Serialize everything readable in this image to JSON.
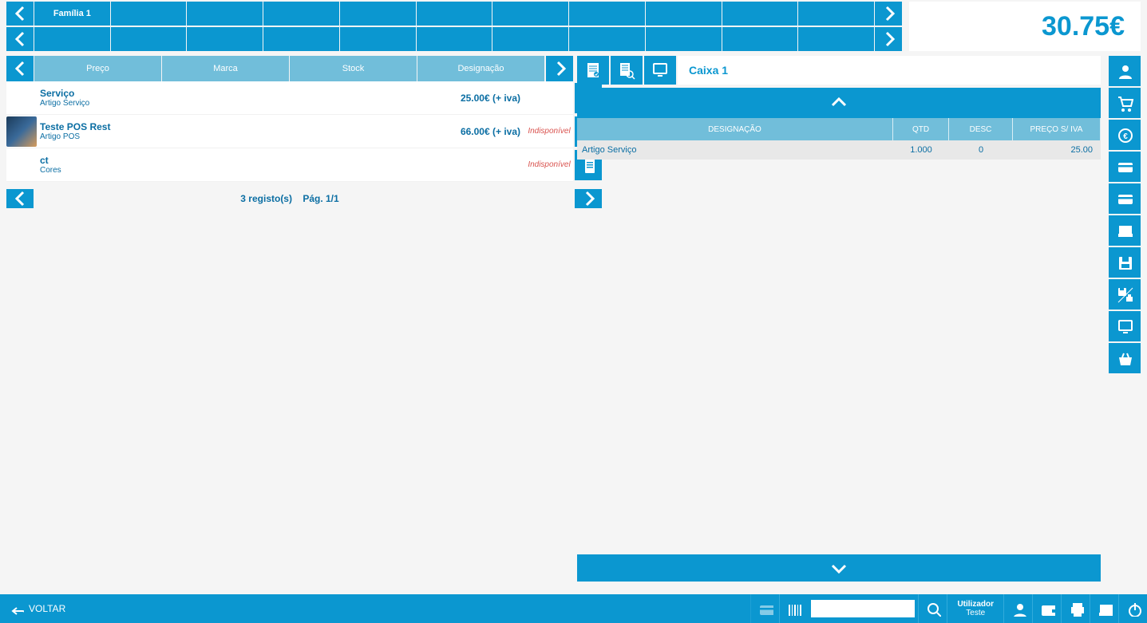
{
  "total": "30.75€",
  "categories": {
    "row1": [
      "Família 1",
      "",
      "",
      "",
      "",
      "",
      "",
      "",
      "",
      "",
      ""
    ],
    "row2": [
      "",
      "",
      "",
      "",
      "",
      "",
      "",
      "",
      "",
      "",
      ""
    ]
  },
  "columns": [
    "Preço",
    "Marca",
    "Stock",
    "Designação"
  ],
  "products": [
    {
      "name": "Serviço",
      "sub": "Artigo Serviço",
      "price": "25.00€ (+ iva)",
      "status": "",
      "thumb": false
    },
    {
      "name": "Teste POS Rest",
      "sub": "Artigo POS",
      "price": "66.00€ (+ iva)",
      "status": "Indisponível",
      "thumb": true
    },
    {
      "name": "ct",
      "sub": "Cores",
      "price": "",
      "status": "Indisponível",
      "thumb": false
    }
  ],
  "list_footer": {
    "count": "3 registo(s)",
    "page": "Pág. 1/1"
  },
  "right": {
    "title": "Caixa 1",
    "headers": [
      "DESIGNAÇÃO",
      "QTD",
      "DESC",
      "PREÇO S/ IVA"
    ],
    "rows": [
      {
        "name": "Artigo Serviço",
        "qty": "1.000",
        "desc": "0",
        "price": "25.00"
      }
    ]
  },
  "footer": {
    "back": "VOLTAR",
    "user_label": "Utilizador",
    "user_name": "Teste"
  }
}
